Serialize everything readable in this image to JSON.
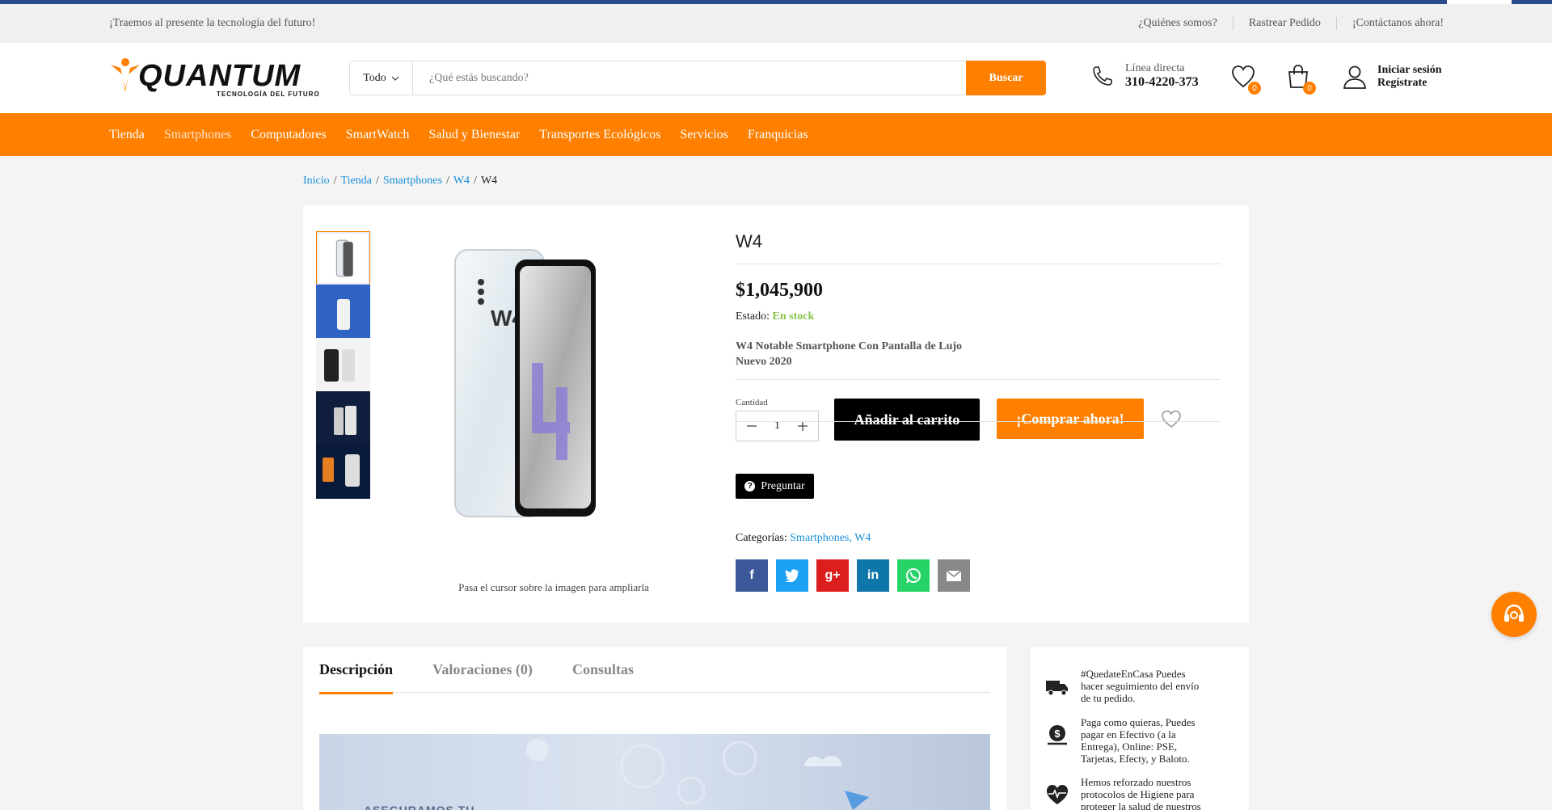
{
  "topbar": {
    "tagline": "¡Traemos al presente la tecnología del futuro!",
    "links": [
      "¿Quiénes somos?",
      "Rastrear Pedido",
      "¡Contáctanos ahora!"
    ]
  },
  "header": {
    "logo_word": "QUANTUM",
    "logo_sub": "TECNOLOGÍA DEL FUTURO",
    "search_category": "Todo",
    "search_placeholder": "¿Qué estás buscando?",
    "search_button": "Buscar",
    "hotline_label": "Línea directa",
    "hotline_number": "310-4220-373",
    "wishlist_count": "0",
    "cart_count": "0",
    "login": "Iniciar sesión",
    "register": "Regístrate"
  },
  "nav": {
    "items": [
      "Tienda",
      "Smartphones",
      "Computadores",
      "SmartWatch",
      "Salud y Bienestar",
      "Transportes Ecológicos",
      "Servicios",
      "Franquicias"
    ],
    "active": "Smartphones"
  },
  "breadcrumb": {
    "items": [
      "Inicio",
      "Tienda",
      "Smartphones",
      "W4"
    ],
    "current": "W4",
    "sep": "/"
  },
  "product": {
    "title": "W4",
    "price": "$1,045,900",
    "stock_label": "Estado:",
    "stock_value": "En stock",
    "short_desc": "W4 Notable Smartphone Con Pantalla de Lujo Nuevo 2020",
    "zoom_hint": "Pasa el cursor sobre la imagen para ampliarla",
    "qty_label": "Cantidad",
    "qty": "1",
    "add_to_cart": "Añadir al carrito",
    "buy_now": "¡Comprar ahora!",
    "ask": "Preguntar",
    "categories_label": "Categorías:",
    "categories": "Smartphones, W4",
    "thumb_count": 5,
    "share": [
      {
        "name": "facebook",
        "glyph": "f",
        "color": "#3b5998"
      },
      {
        "name": "twitter",
        "glyph": "t",
        "color": "#1da1f2"
      },
      {
        "name": "google-plus",
        "glyph": "g+",
        "color": "#dd1e1e"
      },
      {
        "name": "linkedin",
        "glyph": "in",
        "color": "#0e76a8"
      },
      {
        "name": "whatsapp",
        "glyph": "w",
        "color": "#25d366"
      },
      {
        "name": "email",
        "glyph": "✉",
        "color": "#888888"
      }
    ]
  },
  "tabs": [
    "Descripción",
    "Valoraciones (0)",
    "Consultas"
  ],
  "banner_text": "ASEGURAMOS TU",
  "features": [
    {
      "icon": "truck-icon",
      "text": "#QuedateEnCasa Puedes hacer seguimiento del envío de tu pedido."
    },
    {
      "icon": "money-bag-icon",
      "text": "Paga como quieras, Puedes pagar en Efectivo (a la Entrega), Online: PSE, Tarjetas, Efecty, y Baloto."
    },
    {
      "icon": "heart-pulse-icon",
      "text": "Hemos reforzado nuestros protocolos de Higiene para proteger la salud de nuestros"
    }
  ],
  "colors": {
    "accent": "#ff7f00",
    "link": "#1a8fd6",
    "stock": "#8bc34a"
  }
}
